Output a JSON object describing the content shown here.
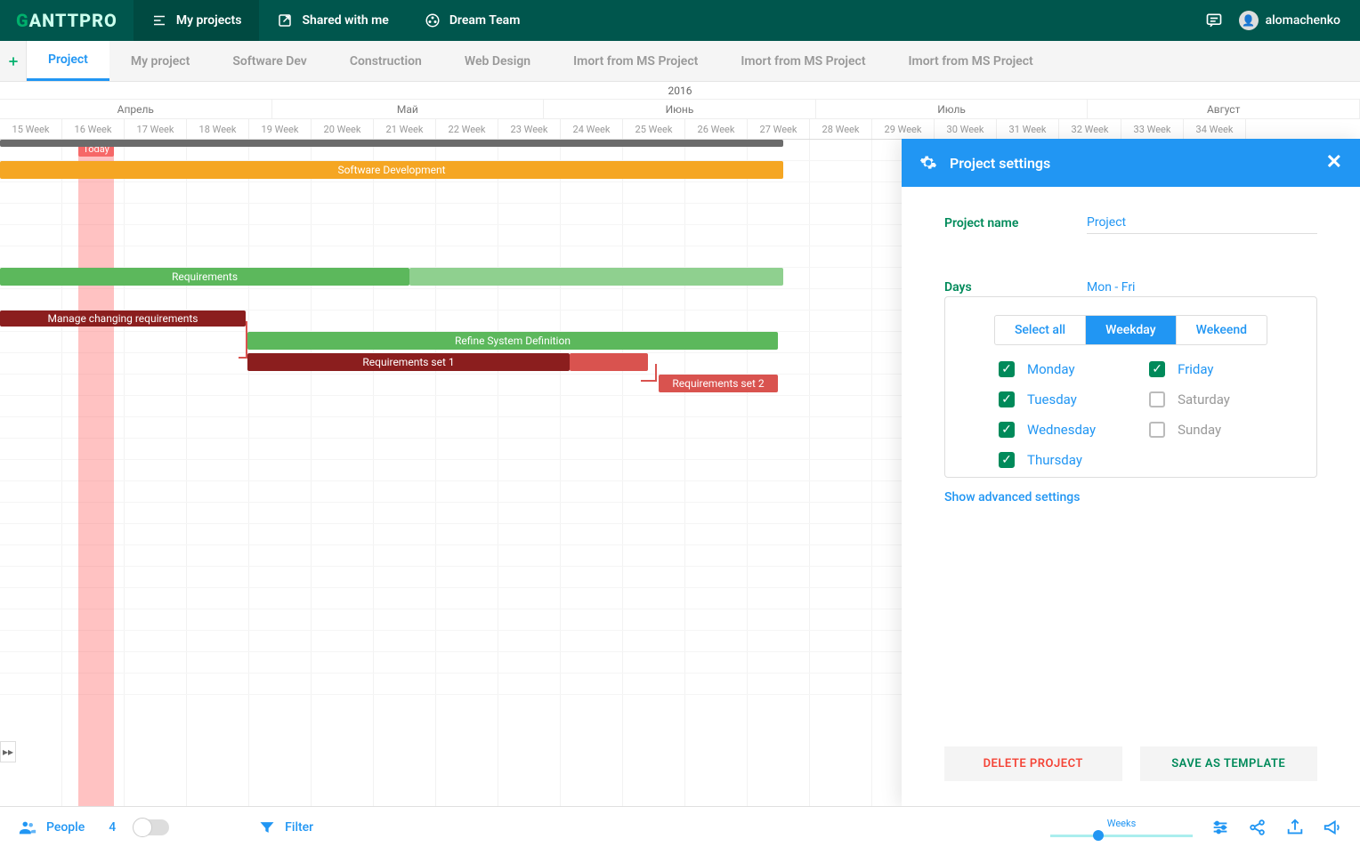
{
  "brand": {
    "prefix": "G",
    "rest": "ANTTPRO"
  },
  "header": {
    "nav": [
      {
        "label": "My projects",
        "icon": "list"
      },
      {
        "label": "Shared with me",
        "icon": "share-out"
      },
      {
        "label": "Dream Team",
        "icon": "team-circle"
      }
    ],
    "username": "alomachenko"
  },
  "tabs": [
    "Project",
    "My project",
    "Software Dev",
    "Construction",
    "Web Design",
    "Imort from MS Project",
    "Imort from MS Project",
    "Imort from MS Project"
  ],
  "active_tab_index": 0,
  "timeline": {
    "year": "2016",
    "months": [
      "Апрель",
      "Май",
      "Июнь",
      "Июль",
      "Август"
    ],
    "weeks": [
      "15 Week",
      "16 Week",
      "17 Week",
      "18 Week",
      "19 Week",
      "20 Week",
      "21 Week",
      "22 Week",
      "23 Week",
      "24 Week",
      "25 Week",
      "26 Week",
      "27 Week",
      "28 Week",
      "29 Week",
      "30 Week",
      "31 Week",
      "32 Week",
      "33 Week",
      "34 Week"
    ],
    "today_label": "Today"
  },
  "bars": {
    "software_dev": "Software Development",
    "requirements": "Requirements",
    "manage": "Manage changing requirements",
    "refine": "Refine System Definition",
    "req1": "Requirements set 1",
    "req2": "Requirements set 2"
  },
  "settings": {
    "title": "Project settings",
    "project_name_label": "Project name",
    "project_name_value": "Project",
    "days_label": "Days",
    "days_value": "Mon - Fri",
    "day_tabs": [
      "Select all",
      "Weekday",
      "Wekeend"
    ],
    "active_day_tab": 1,
    "days_left": [
      {
        "label": "Monday",
        "on": true
      },
      {
        "label": "Tuesday",
        "on": true
      },
      {
        "label": "Wednesday",
        "on": true
      },
      {
        "label": "Thursday",
        "on": true
      }
    ],
    "days_right": [
      {
        "label": "Friday",
        "on": true
      },
      {
        "label": "Saturday",
        "on": false
      },
      {
        "label": "Sunday",
        "on": false
      }
    ],
    "advanced_link": "Show advanced settings",
    "delete_btn": "DELETE PROJECT",
    "save_btn": "SAVE AS TEMPLATE"
  },
  "bottom": {
    "people_label": "People",
    "people_count": "4",
    "filter_label": "Filter",
    "zoom_label": "Weeks"
  }
}
